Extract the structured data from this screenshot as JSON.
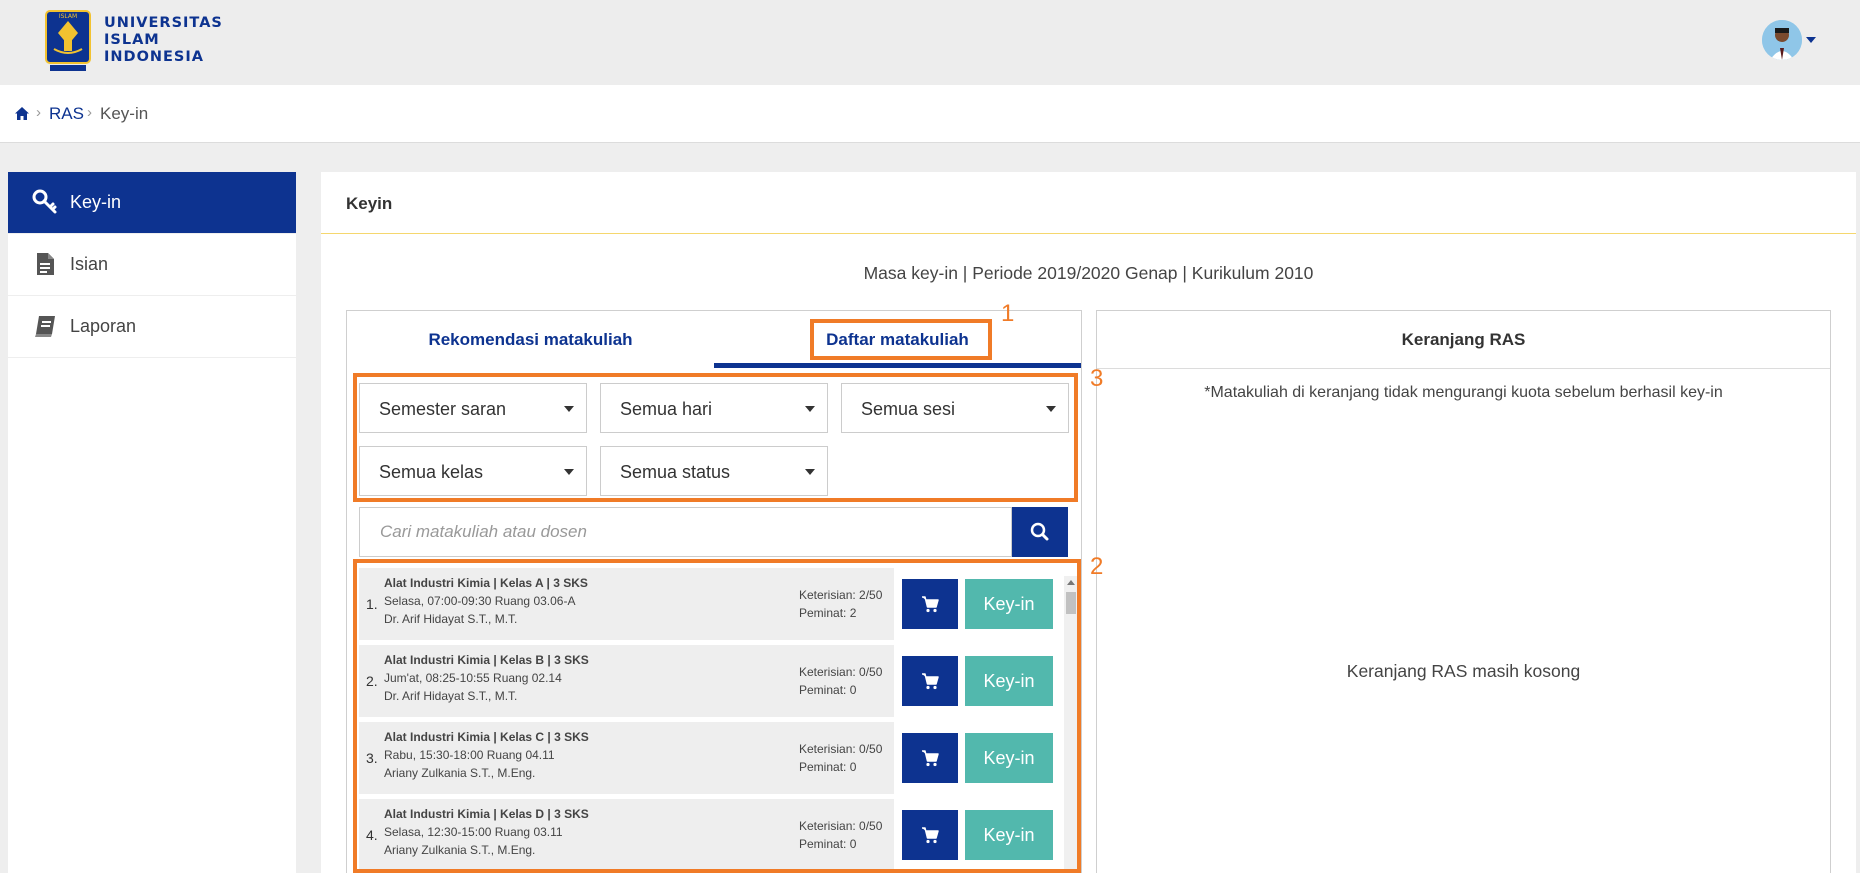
{
  "header": {
    "logo_text": [
      "UNIVERSITAS",
      "ISLAM",
      "INDONESIA"
    ],
    "logo_badge_text": "ISLAM",
    "brand_color": "#0d3390"
  },
  "breadcrumb": {
    "home_icon": "home-icon",
    "items": [
      "RAS",
      "Key-in"
    ],
    "separator": "›"
  },
  "sidebar": {
    "items": [
      {
        "label": "Key-in",
        "icon": "key-icon",
        "active": true
      },
      {
        "label": "Isian",
        "icon": "document-icon",
        "active": false
      },
      {
        "label": "Laporan",
        "icon": "book-icon",
        "active": false
      }
    ]
  },
  "main": {
    "title": "Keyin",
    "period": "Masa key-in | Periode 2019/2020 Genap | Kurikulum 2010",
    "tabs": [
      {
        "label": "Rekomendasi matakuliah",
        "active": false
      },
      {
        "label": "Daftar matakuliah",
        "active": true
      }
    ],
    "filters": [
      {
        "label": "Semester saran"
      },
      {
        "label": "Semua hari"
      },
      {
        "label": "Semua sesi"
      },
      {
        "label": "Semua kelas"
      },
      {
        "label": "Semua status"
      }
    ],
    "search": {
      "placeholder": "Cari matakuliah atau dosen",
      "value": ""
    },
    "courses": [
      {
        "num": "1.",
        "title": "Alat Industri Kimia | Kelas A | 3 SKS",
        "schedule": "Selasa, 07:00-09:30 Ruang 03.06-A",
        "lecturer": "Dr. Arif Hidayat S.T., M.T.",
        "keterisian": "Keterisian: 2/50",
        "peminat": "Peminat: 2",
        "button": "Key-in"
      },
      {
        "num": "2.",
        "title": "Alat Industri Kimia | Kelas B | 3 SKS",
        "schedule": "Jum'at, 08:25-10:55 Ruang 02.14",
        "lecturer": "Dr. Arif Hidayat S.T., M.T.",
        "keterisian": "Keterisian: 0/50",
        "peminat": "Peminat: 0",
        "button": "Key-in"
      },
      {
        "num": "3.",
        "title": "Alat Industri Kimia | Kelas C | 3 SKS",
        "schedule": "Rabu, 15:30-18:00 Ruang 04.11",
        "lecturer": "Ariany Zulkania S.T., M.Eng.",
        "keterisian": "Keterisian: 0/50",
        "peminat": "Peminat: 0",
        "button": "Key-in"
      },
      {
        "num": "4.",
        "title": "Alat Industri Kimia | Kelas D | 3 SKS",
        "schedule": "Selasa, 12:30-15:00 Ruang 03.11",
        "lecturer": "Ariany Zulkania S.T., M.Eng.",
        "keterisian": "Keterisian: 0/50",
        "peminat": "Peminat: 0",
        "button": "Key-in"
      }
    ]
  },
  "cart": {
    "title": "Keranjang RAS",
    "note": "*Matakuliah di keranjang tidak mengurangi kuota sebelum berhasil key-in",
    "empty": "Keranjang RAS masih kosong"
  },
  "annotations": {
    "labels": [
      "1",
      "2",
      "3"
    ],
    "color": "#f07b27"
  }
}
